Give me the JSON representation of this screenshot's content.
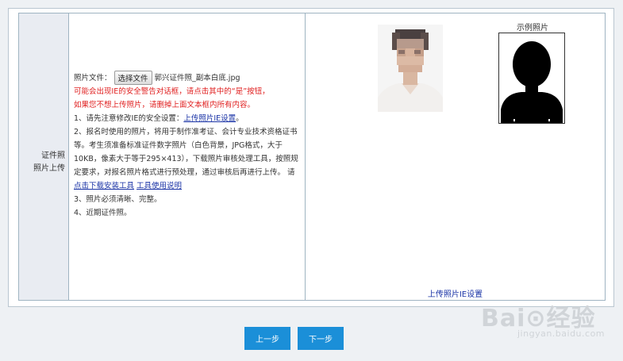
{
  "form": {
    "label_line1": "证件照",
    "label_line2": "照片上传",
    "file_label": "照片文件：",
    "choose_button": "选择文件",
    "file_name": "郭兴证件照_副本白底.jpg",
    "warning_line1": "可能会出现IE的安全警告对话框，请点击其中的“是”按钮，",
    "warning_line2": "如果您不想上传照片，请删掉上面文本框内所有内容。",
    "note1_prefix": "1、请先注意修改IE的安全设置：",
    "note1_link": "上传照片IE设置",
    "note1_suffix": "。",
    "note2_text": "2、报名时使用的照片，将用于制作准考证、会计专业技术资格证书等。考生须准备标准证件数字照片（白色背景，JPG格式，大于10KB，像素大于等于295×413），下载照片审核处理工具，按照规定要求，对报名照片格式进行预处理，通过审核后再进行上传。  请",
    "note2_link1": "点击下载安装工具",
    "note2_link2": "工具使用说明",
    "note3": "3、照片必须清晰、完整。",
    "note4": "4、近期证件照。"
  },
  "photo_panel": {
    "example_title": "示例照片",
    "ie_link": "上传照片IE设置"
  },
  "buttons": {
    "prev": "上一步",
    "next": "下一步"
  },
  "watermark": {
    "main": "Bai⊙经验",
    "sub": "jingyan.baidu.com"
  },
  "colors": {
    "accent_button": "#1b8fd8",
    "warning_text": "#e02020",
    "link": "#1a33a6",
    "label_cell_bg": "#e9ecf2"
  }
}
